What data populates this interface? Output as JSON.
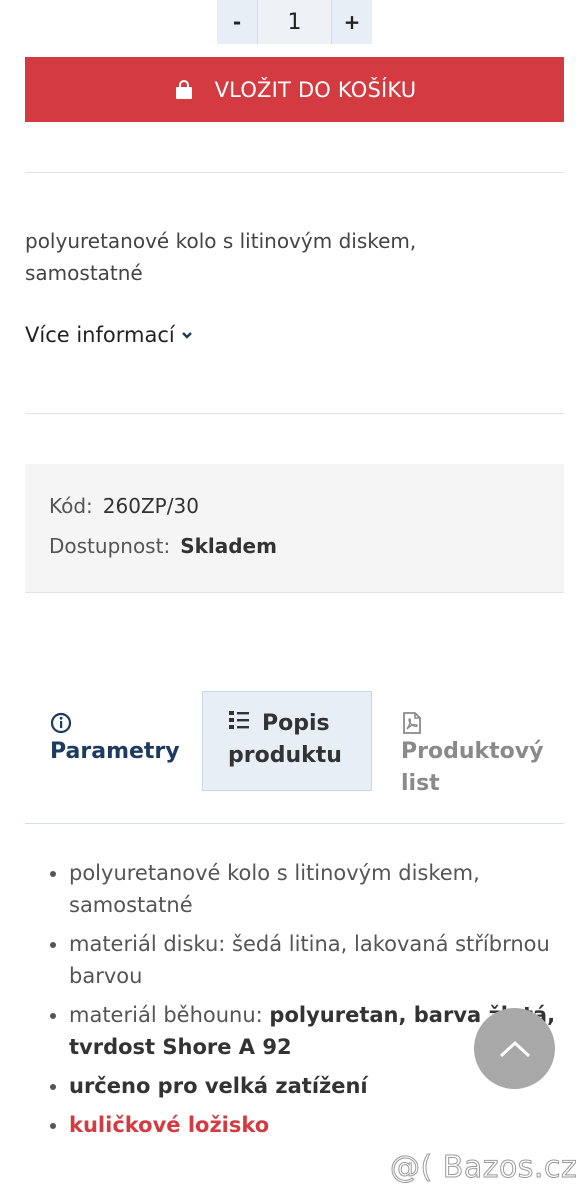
{
  "quantity": {
    "minus": "-",
    "value": "1",
    "plus": "+"
  },
  "cart_button": {
    "label": "VLOŽIT DO KOŠÍKU",
    "icon": "shopping-bag-icon"
  },
  "description": {
    "text": "polyuretanové kolo s litinovým diskem, samostatné"
  },
  "more_info": {
    "label": "Více informací",
    "icon": "chevron-down-icon"
  },
  "info": {
    "code_label": "Kód:",
    "code_value": "260ZP/30",
    "availability_label": "Dostupnost:",
    "availability_value": "Skladem"
  },
  "tabs": [
    {
      "label": "Parametry",
      "icon": "info-circle-icon",
      "active": false
    },
    {
      "label": "Popis produktu",
      "icon": "list-icon",
      "active": true
    },
    {
      "label": "Produktový list",
      "icon": "pdf-file-icon",
      "active": false
    }
  ],
  "features": {
    "b1": "polyuretanové kolo s litinovým diskem, samostatné",
    "b2": "materiál disku: šedá litina, lakovaná stříbrnou barvou",
    "b3_prefix": "materiál běhounu: ",
    "b3_bold": "polyuretan, barva žlutá, tvrdost Shore A 92",
    "b4": "určeno pro velká zatížení",
    "b5": "kuličkové ložisko"
  },
  "watermark": "@( Bazos.cz",
  "colors": {
    "accent_red": "#d33b41",
    "active_tab_bg": "#e7eef6",
    "link_blue": "#1d3a5f"
  }
}
